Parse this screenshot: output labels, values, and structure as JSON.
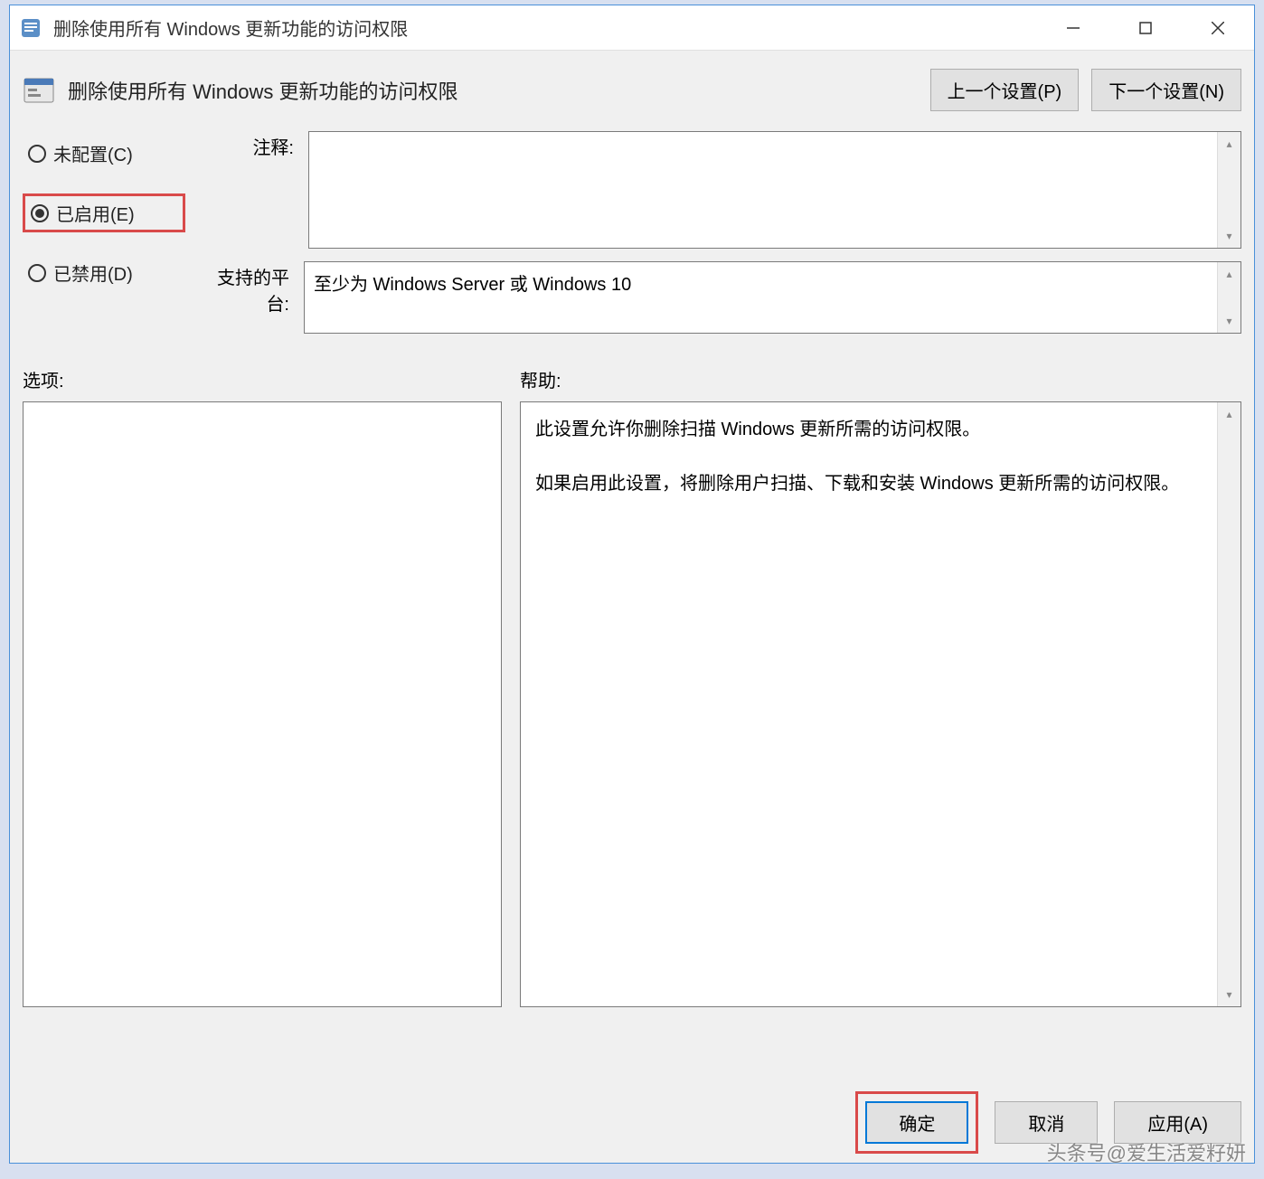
{
  "titlebar": {
    "title": "删除使用所有 Windows 更新功能的访问权限"
  },
  "header": {
    "title": "删除使用所有 Windows 更新功能的访问权限",
    "prev": "上一个设置(P)",
    "next": "下一个设置(N)"
  },
  "radios": {
    "not_configured": "未配置(C)",
    "enabled": "已启用(E)",
    "disabled": "已禁用(D)"
  },
  "labels": {
    "comment": "注释:",
    "platform": "支持的平台:",
    "options": "选项:",
    "help": "帮助:"
  },
  "platform_text": "至少为 Windows Server 或 Windows 10",
  "help_text": {
    "p1": "此设置允许你删除扫描 Windows 更新所需的访问权限。",
    "p2": "如果启用此设置，将删除用户扫描、下载和安装 Windows 更新所需的访问权限。"
  },
  "buttons": {
    "ok": "确定",
    "cancel": "取消",
    "apply": "应用(A)"
  },
  "watermark": "头条号@爱生活爱籽妍"
}
